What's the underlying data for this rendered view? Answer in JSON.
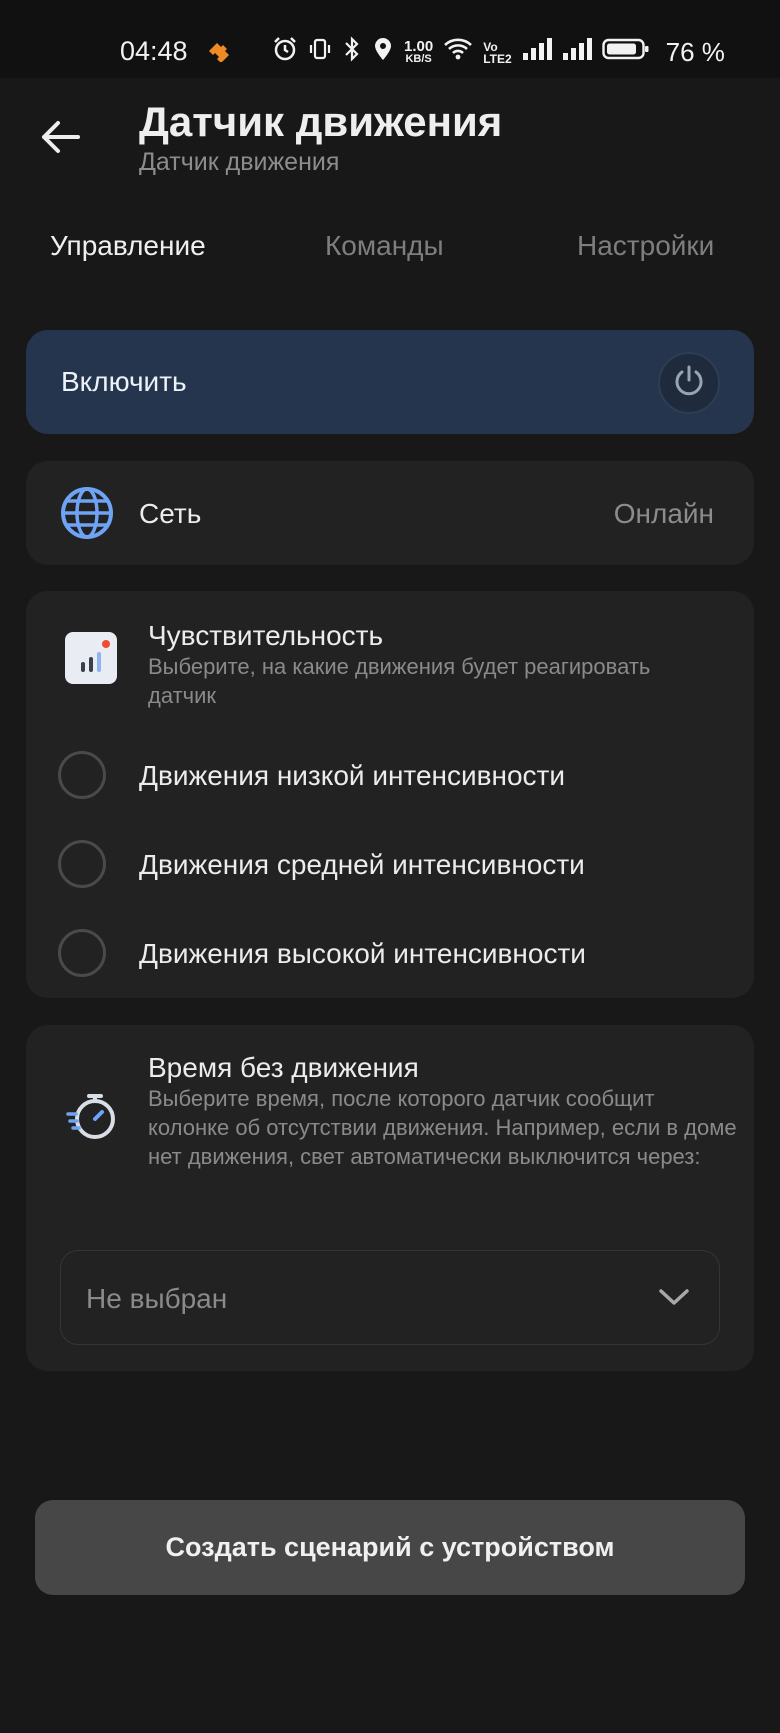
{
  "status_bar": {
    "time": "04:48",
    "speed_value": "1.00",
    "speed_unit": "KB/S",
    "volte_line1": "Vo",
    "volte_line2": "LTE2",
    "battery_pct": "76 %",
    "icons": [
      "app-notification-icon",
      "alarm-icon",
      "vibrate-icon",
      "bluetooth-icon",
      "location-icon",
      "wifi-icon",
      "signal-icon",
      "signal-icon",
      "battery-icon"
    ]
  },
  "header": {
    "title": "Датчик движения",
    "subtitle": "Датчик движения",
    "back_icon": "arrow-left-icon"
  },
  "tabs": [
    {
      "label": "Управление",
      "active": true
    },
    {
      "label": "Команды",
      "active": false
    },
    {
      "label": "Настройки",
      "active": false
    }
  ],
  "power_card": {
    "label": "Включить",
    "icon": "power-icon"
  },
  "network_card": {
    "label": "Сеть",
    "status": "Онлайн",
    "icon": "globe-icon"
  },
  "sensitivity_card": {
    "title": "Чувствительность",
    "description": "Выберите, на какие движения будет реагировать датчик",
    "icon": "signal-bars-icon",
    "options": [
      {
        "label": "Движения низкой интенсивности",
        "selected": false
      },
      {
        "label": "Движения средней интенсивности",
        "selected": false
      },
      {
        "label": "Движения высокой интенсивности",
        "selected": false
      }
    ]
  },
  "no_motion_card": {
    "title": "Время без движения",
    "description": "Выберите время, после которого датчик сообщит колонке об отсутствии движения. Например, если в доме нет движения, свет автоматически выключится через:",
    "icon": "stopwatch-icon",
    "select_value": "Не выбран"
  },
  "create_button": {
    "label": "Создать сценарий с устройством"
  },
  "colors": {
    "background": "#181818",
    "card": "#222222",
    "power_card": "#25354d",
    "accent_blue": "#6fa3f5",
    "muted_text": "#8a8a8a"
  }
}
